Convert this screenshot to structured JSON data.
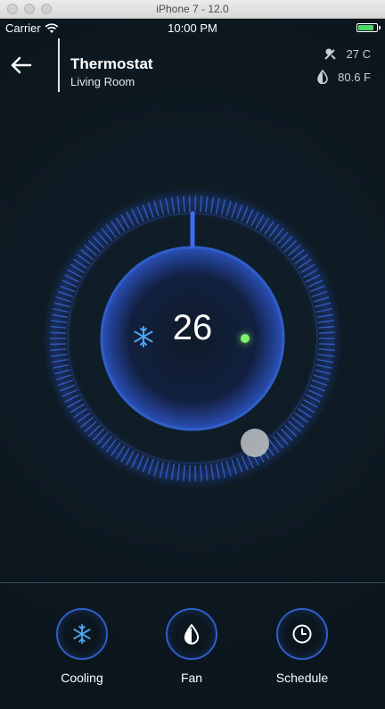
{
  "window": {
    "title": "iPhone 7 - 12.0"
  },
  "status_bar": {
    "carrier": "Carrier",
    "time": "10:00 PM"
  },
  "header": {
    "title": "Thermostat",
    "subtitle": "Living Room",
    "outdoor_temp": "27 C",
    "humidity": "80.6 F"
  },
  "dial": {
    "temperature": "26",
    "mode_icon": "snowflake-icon",
    "status_dot_color": "#7ef06f"
  },
  "modes": [
    {
      "label": "Cooling",
      "icon": "snowflake-icon"
    },
    {
      "label": "Fan",
      "icon": "drop-icon"
    },
    {
      "label": "Schedule",
      "icon": "clock-icon"
    }
  ],
  "colors": {
    "accent": "#2f5ec8",
    "snowflake": "#4aa6f0",
    "battery": "#4cd964"
  }
}
